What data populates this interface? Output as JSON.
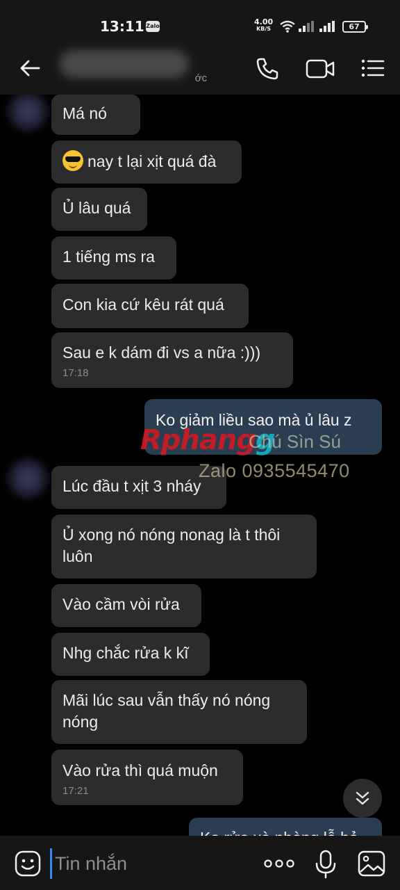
{
  "status_bar": {
    "time": "13:11",
    "zalo_badge": "Zalo",
    "net_speed": "4.00",
    "net_speed_unit": "KB/S",
    "battery": "67"
  },
  "header": {
    "contact_name": "",
    "contact_status_fragment": "ớc",
    "icons": [
      "back-arrow-icon",
      "phone-icon",
      "video-call-icon",
      "menu-list-icon"
    ]
  },
  "messages": [
    {
      "dir": "in",
      "text": "Má nó"
    },
    {
      "dir": "in",
      "text": "nay t lại xịt quá đà",
      "emoji": "cool-sunglasses-emoji"
    },
    {
      "dir": "in",
      "text": "Ủ lâu quá"
    },
    {
      "dir": "in",
      "text": "1 tiếng ms ra"
    },
    {
      "dir": "in",
      "text": "Con kia cứ kêu rát quá"
    },
    {
      "dir": "in",
      "text": "Sau e k dám đi vs a nữa :)))",
      "time": "17:18"
    },
    {
      "dir": "out",
      "text": "Ko giảm liều sao mà ủ lâu z"
    },
    {
      "dir": "in",
      "text": "Lúc đầu t xịt 3 nháy"
    },
    {
      "dir": "in",
      "text": "Ủ xong nó nóng nonag là t thôi",
      "text2": "luôn"
    },
    {
      "dir": "in",
      "text": "Vào cầm vòi rửa"
    },
    {
      "dir": "in",
      "text": "Nhg chắc rửa k kĩ"
    },
    {
      "dir": "in",
      "text": "Mãi lúc sau vẫn thấy nó nóng",
      "text2": "nóng"
    },
    {
      "dir": "in",
      "text": "Vào rửa thì quá muộn",
      "time": "17:21"
    },
    {
      "dir": "out",
      "text": "Ko rửa xà phòng lỗ bỏ"
    }
  ],
  "watermark": {
    "brand_part1": "Rphang",
    "brand_part2": "g",
    "sub": "Chú Sìn Sú",
    "zalo": "Zalo 0935545470"
  },
  "composer": {
    "placeholder": "Tin nhắn",
    "value": ""
  },
  "colors": {
    "incoming_bubble": "#2c2c2e",
    "outgoing_bubble": "#2b3e51",
    "background": "#000000",
    "bars": "#161616",
    "cursor_accent": "#2f8cf2"
  }
}
